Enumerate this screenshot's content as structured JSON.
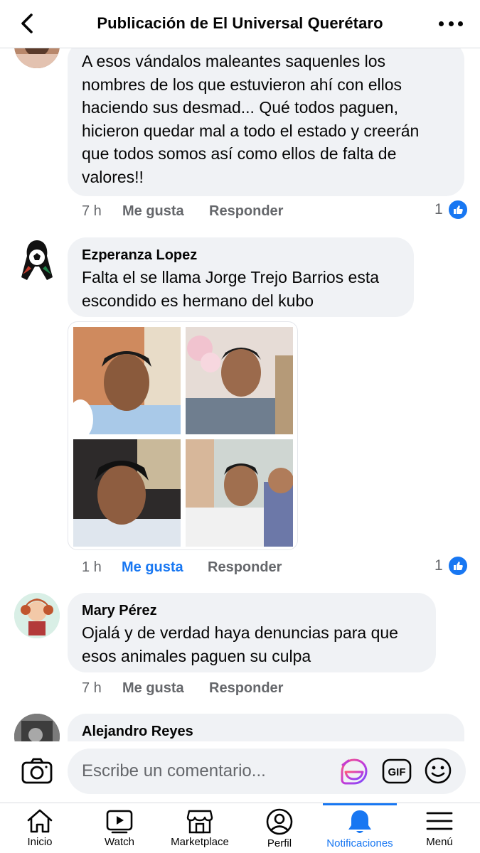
{
  "header": {
    "title": "Publicación de El Universal Querétaro"
  },
  "comments": [
    {
      "author": "",
      "lines": [
        "A esos vándalos maleantes saquenles los",
        "nombres de los que estuvieron ahí con ellos",
        "haciendo sus desmad... Qué todos paguen,",
        "hicieron quedar mal a todo el estado y creerán",
        "que todos somos así como ellos de falta de",
        "valores!!"
      ],
      "time": "7 h",
      "like_label": "Me gusta",
      "reply_label": "Responder",
      "reaction_count": "1",
      "liked": false
    },
    {
      "author": "Ezperanza Lopez",
      "lines": [
        "Falta el se llama Jorge Trejo Barrios esta",
        "escondido es hermano del kubo"
      ],
      "time": "1 h",
      "like_label": "Me gusta",
      "reply_label": "Responder",
      "reaction_count": "1",
      "liked": true
    },
    {
      "author": "Mary Pérez",
      "lines": [
        "Ojalá y de verdad haya denuncias para que",
        "esos animales paguen su culpa"
      ],
      "time": "7 h",
      "like_label": "Me gusta",
      "reply_label": "Responder",
      "liked": false
    },
    {
      "author": "Alejandro Reyes",
      "lines": []
    }
  ],
  "composer": {
    "placeholder": "Escribe un comentario..."
  },
  "tabbar": {
    "tabs": [
      {
        "label": "Inicio",
        "icon": "home-icon"
      },
      {
        "label": "Watch",
        "icon": "watch-icon"
      },
      {
        "label": "Marketplace",
        "icon": "marketplace-icon"
      },
      {
        "label": "Perfil",
        "icon": "profile-icon"
      },
      {
        "label": "Notificaciones",
        "icon": "bell-icon",
        "active": true
      },
      {
        "label": "Menú",
        "icon": "menu-icon"
      }
    ]
  },
  "colors": {
    "accent": "#1877f2",
    "bubble": "#f0f2f5",
    "secondary_text": "#65676b"
  }
}
